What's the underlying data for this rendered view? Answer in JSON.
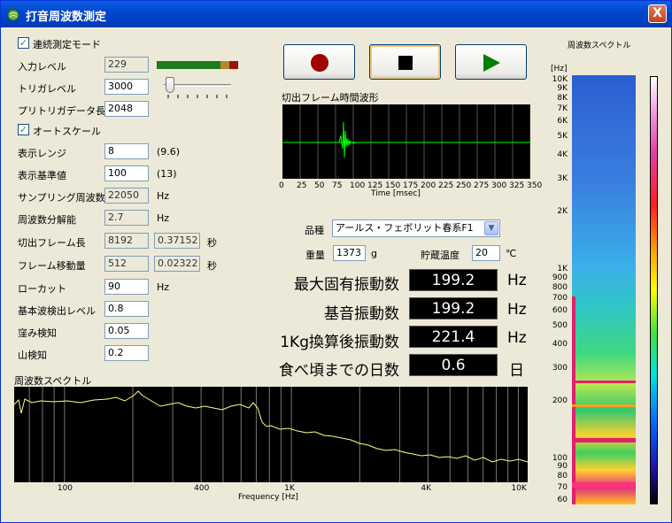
{
  "window": {
    "title": "打音周波数測定",
    "close_symbol": "X"
  },
  "left": {
    "continuous_mode_label": "連続測定モード",
    "input_level_label": "入力レベル",
    "input_level_value": "229",
    "trigger_level_label": "トリガレベル",
    "trigger_level_value": "3000",
    "pretrigger_label": "プリトリガデータ長",
    "pretrigger_value": "2048",
    "autoscale_label": "オートスケール",
    "display_range_label": "表示レンジ",
    "display_range_value": "8",
    "display_range_hint": "(9.6)",
    "display_ref_label": "表示基準値",
    "display_ref_value": "100",
    "display_ref_hint": "(13)",
    "sampling_label": "サンプリング周波数",
    "sampling_value": "22050",
    "sampling_unit": "Hz",
    "freq_res_label": "周波数分解能",
    "freq_res_value": "2.7",
    "freq_res_unit": "Hz",
    "frame_len_label": "切出フレーム長",
    "frame_len_value": "8192",
    "frame_len_sec": "0.37152",
    "frame_len_unit": "秒",
    "frame_shift_label": "フレーム移動量",
    "frame_shift_value": "512",
    "frame_shift_sec": "0.02322",
    "frame_shift_unit": "秒",
    "lowcut_label": "ローカット",
    "lowcut_value": "90",
    "lowcut_unit": "Hz",
    "fund_level_label": "基本波検出レベル",
    "fund_level_value": "0.8",
    "valley_label": "窪み検知",
    "valley_value": "0.05",
    "peak_label": "山検知",
    "peak_value": "0.2"
  },
  "waveform": {
    "title": "切出フレーム時間波形",
    "x_ticks": [
      "0",
      "25",
      "50",
      "75",
      "100",
      "125",
      "150",
      "175",
      "200",
      "225",
      "250",
      "275",
      "300",
      "325",
      "350"
    ],
    "x_label": "Time [msec]"
  },
  "params": {
    "variety_label": "品種",
    "variety_value": "アールス・フェボリット春系F1",
    "weight_label": "重量",
    "weight_value": "1373",
    "weight_unit": "g",
    "storage_temp_label": "貯蔵温度",
    "storage_temp_value": "20",
    "storage_temp_unit": "℃"
  },
  "results": [
    {
      "label": "最大固有振動数",
      "value": "199.2",
      "unit": "Hz"
    },
    {
      "label": "基音振動数",
      "value": "199.2",
      "unit": "Hz"
    },
    {
      "label": "1Kg換算後振動数",
      "value": "221.4",
      "unit": "Hz"
    },
    {
      "label": "食べ頃までの日数",
      "value": "0.6",
      "unit": "日"
    }
  ],
  "spectrum": {
    "title": "周波数スペクトル",
    "x_ticks": [
      "100",
      "400",
      "1K",
      "4K",
      "10K"
    ],
    "x_label": "Frequency [Hz]"
  },
  "spectrogram": {
    "title": "周波数スペクトル",
    "unit_label": "[Hz]",
    "y_ticks": [
      "10K",
      "9K",
      "8K",
      "7K",
      "6K",
      "5K",
      "4K",
      "3K",
      "2K",
      "1K",
      "900",
      "800",
      "700",
      "600",
      "500",
      "400",
      "300",
      "200",
      "100",
      "90",
      "80",
      "70",
      "60"
    ]
  },
  "colors": {
    "titlebar": "#0047d1",
    "record": "#a00000",
    "play": "#008000",
    "wave": "#00ff00",
    "spectrum_line": "#ffff80"
  }
}
